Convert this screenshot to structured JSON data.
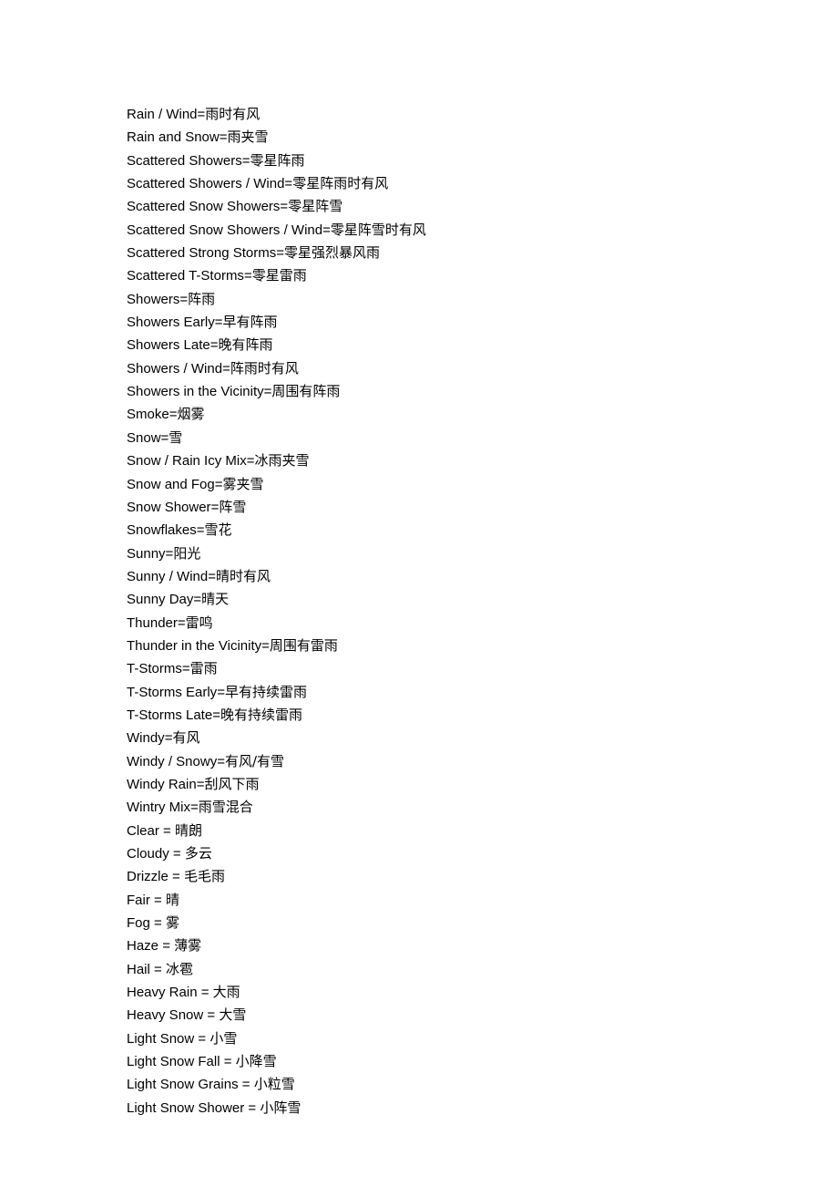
{
  "document": {
    "type": "weather-terms-glossary",
    "language_pair": "English-Chinese",
    "background_color": "#ffffff",
    "text_color": "#000000",
    "entries": [
      {
        "term": "Rain / Wind",
        "sep": "=",
        "translation": "雨时有风"
      },
      {
        "term": "Rain and Snow",
        "sep": "=",
        "translation": "雨夹雪"
      },
      {
        "term": "Scattered Showers",
        "sep": "=",
        "translation": "零星阵雨"
      },
      {
        "term": "Scattered Showers / Wind",
        "sep": "=",
        "translation": "零星阵雨时有风"
      },
      {
        "term": "Scattered Snow Showers",
        "sep": "=",
        "translation": "零星阵雪"
      },
      {
        "term": "Scattered Snow Showers / Wind",
        "sep": "=",
        "translation": "零星阵雪时有风"
      },
      {
        "term": "Scattered Strong Storms",
        "sep": "=",
        "translation": "零星强烈暴风雨"
      },
      {
        "term": "Scattered T-Storms",
        "sep": "=",
        "translation": "零星雷雨"
      },
      {
        "term": "Showers",
        "sep": "=",
        "translation": "阵雨"
      },
      {
        "term": "Showers Early",
        "sep": "=",
        "translation": "早有阵雨"
      },
      {
        "term": "Showers Late",
        "sep": "=",
        "translation": "晚有阵雨"
      },
      {
        "term": "Showers / Wind",
        "sep": "=",
        "translation": "阵雨时有风"
      },
      {
        "term": "Showers in the Vicinity",
        "sep": "=",
        "translation": "周围有阵雨"
      },
      {
        "term": "Smoke",
        "sep": "=",
        "translation": "烟雾"
      },
      {
        "term": "Snow",
        "sep": "=",
        "translation": "雪"
      },
      {
        "term": "Snow / Rain Icy Mix",
        "sep": "=",
        "translation": "冰雨夹雪"
      },
      {
        "term": "Snow and Fog",
        "sep": "=",
        "translation": "雾夹雪"
      },
      {
        "term": "Snow Shower",
        "sep": "=",
        "translation": "阵雪"
      },
      {
        "term": "Snowflakes",
        "sep": "=",
        "translation": "雪花"
      },
      {
        "term": "Sunny",
        "sep": "=",
        "translation": "阳光"
      },
      {
        "term": "Sunny / Wind",
        "sep": "=",
        "translation": "晴时有风"
      },
      {
        "term": "Sunny Day",
        "sep": "=",
        "translation": "晴天"
      },
      {
        "term": "Thunder",
        "sep": "=",
        "translation": "雷鸣"
      },
      {
        "term": "Thunder in the Vicinity",
        "sep": "=",
        "translation": "周围有雷雨"
      },
      {
        "term": "T-Storms",
        "sep": "=",
        "translation": "雷雨"
      },
      {
        "term": "T-Storms Early",
        "sep": "=",
        "translation": "早有持续雷雨"
      },
      {
        "term": "T-Storms Late",
        "sep": "=",
        "translation": "晚有持续雷雨"
      },
      {
        "term": "Windy",
        "sep": "=",
        "translation": "有风"
      },
      {
        "term": "Windy / Snowy",
        "sep": "=",
        "translation": "有风/有雪"
      },
      {
        "term": "Windy Rain",
        "sep": "=",
        "translation": "刮风下雨"
      },
      {
        "term": "Wintry Mix",
        "sep": "=",
        "translation": "雨雪混合"
      },
      {
        "term": "Clear",
        "sep": " = ",
        "translation": "晴朗"
      },
      {
        "term": "Cloudy",
        "sep": " = ",
        "translation": "多云"
      },
      {
        "term": "Drizzle",
        "sep": " = ",
        "translation": "毛毛雨"
      },
      {
        "term": "Fair",
        "sep": " = ",
        "translation": "晴"
      },
      {
        "term": "Fog",
        "sep": " = ",
        "translation": "雾"
      },
      {
        "term": "Haze",
        "sep": " = ",
        "translation": "薄雾"
      },
      {
        "term": "Hail",
        "sep": " = ",
        "translation": "冰雹"
      },
      {
        "term": "Heavy Rain",
        "sep": " = ",
        "translation": "大雨"
      },
      {
        "term": "Heavy Snow",
        "sep": " = ",
        "translation": "大雪"
      },
      {
        "term": "Light Snow",
        "sep": " = ",
        "translation": "小雪"
      },
      {
        "term": "Light Snow Fall",
        "sep": " = ",
        "translation": "小降雪"
      },
      {
        "term": "Light Snow Grains",
        "sep": " = ",
        "translation": "小粒雪"
      },
      {
        "term": "Light Snow Shower",
        "sep": " = ",
        "translation": "小阵雪"
      }
    ]
  }
}
